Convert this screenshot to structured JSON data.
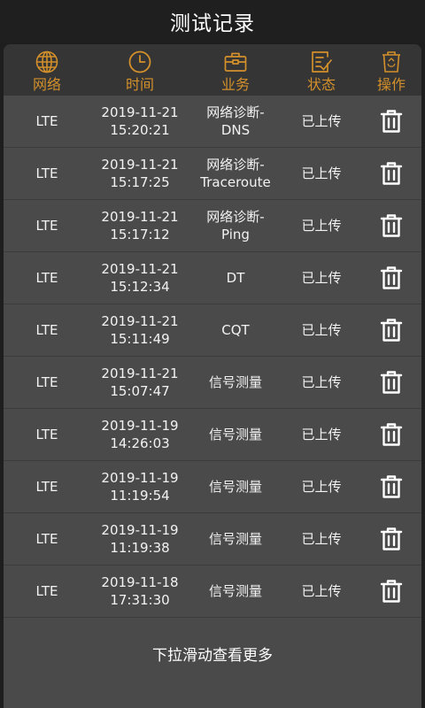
{
  "title": "测试记录",
  "header": {
    "network": "网络",
    "time": "时间",
    "business": "业务",
    "status": "状态",
    "action": "操作"
  },
  "icons": {
    "network": "globe-icon",
    "time": "clock-icon",
    "business": "briefcase-icon",
    "status": "checklist-icon",
    "action": "recycle-bin-icon",
    "row_action": "trash-icon"
  },
  "colors": {
    "accent": "#d3902b",
    "background": "#1e1e1e",
    "panel": "#4a4a4a",
    "header_bar": "#353535"
  },
  "records": [
    {
      "network": "LTE",
      "date": "2019-11-21",
      "time": "15:20:21",
      "business_l1": "网络诊断-",
      "business_l2": "DNS",
      "status": "已上传"
    },
    {
      "network": "LTE",
      "date": "2019-11-21",
      "time": "15:17:25",
      "business_l1": "网络诊断-",
      "business_l2": "Traceroute",
      "status": "已上传"
    },
    {
      "network": "LTE",
      "date": "2019-11-21",
      "time": "15:17:12",
      "business_l1": "网络诊断-",
      "business_l2": "Ping",
      "status": "已上传"
    },
    {
      "network": "LTE",
      "date": "2019-11-21",
      "time": "15:12:34",
      "business_l1": "DT",
      "business_l2": "",
      "status": "已上传"
    },
    {
      "network": "LTE",
      "date": "2019-11-21",
      "time": "15:11:49",
      "business_l1": "CQT",
      "business_l2": "",
      "status": "已上传"
    },
    {
      "network": "LTE",
      "date": "2019-11-21",
      "time": "15:07:47",
      "business_l1": "信号测量",
      "business_l2": "",
      "status": "已上传"
    },
    {
      "network": "LTE",
      "date": "2019-11-19",
      "time": "14:26:03",
      "business_l1": "信号测量",
      "business_l2": "",
      "status": "已上传"
    },
    {
      "network": "LTE",
      "date": "2019-11-19",
      "time": "11:19:54",
      "business_l1": "信号测量",
      "business_l2": "",
      "status": "已上传"
    },
    {
      "network": "LTE",
      "date": "2019-11-19",
      "time": "11:19:38",
      "business_l1": "信号测量",
      "business_l2": "",
      "status": "已上传"
    },
    {
      "network": "LTE",
      "date": "2019-11-18",
      "time": "17:31:30",
      "business_l1": "信号测量",
      "business_l2": "",
      "status": "已上传"
    }
  ],
  "footer": "下拉滑动查看更多"
}
